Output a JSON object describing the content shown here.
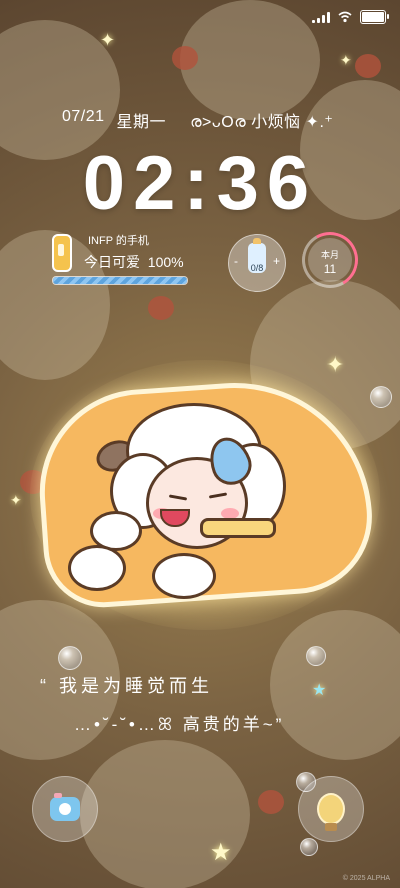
{
  "status_bar": {
    "battery_level": 1.0
  },
  "lockscreen": {
    "date": "07/21",
    "weekday": "星期一",
    "mood_text": "ര>ᴗOര 小烦恼 ✦.⁺",
    "time": "02:36"
  },
  "battery_widget": {
    "owner": "INFP 的手机",
    "label": "今日可爱",
    "percent": "100%",
    "fill": 1.0
  },
  "bottle_widget": {
    "count": "0/8",
    "minus": "-",
    "plus": "+"
  },
  "month_widget": {
    "label": "本月",
    "days": "11",
    "progress": 0.35
  },
  "quote": {
    "line1": "“ 我是为睡觉而生",
    "line2": "…•˘-˘•…ꕤ 高贵的羊~”"
  },
  "footer": {
    "copyright": "© 2025 ALPHA"
  },
  "colors": {
    "accent_pink": "#ff6f91",
    "bar_blue": "#5ea4dd",
    "pillow": "#f6b860"
  },
  "icons": {
    "signal": "signal-icon",
    "wifi": "wifi-icon",
    "battery": "battery-icon",
    "phone": "phone-icon",
    "camera": "camera-icon",
    "bulb": "lightbulb-icon"
  }
}
